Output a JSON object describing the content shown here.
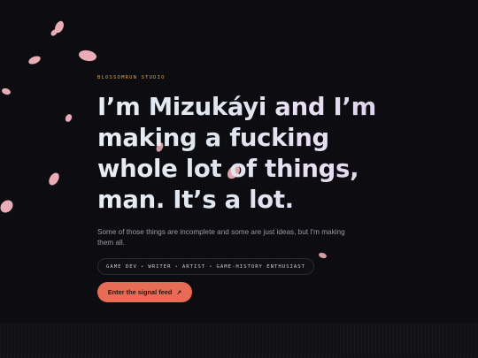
{
  "hero": {
    "eyebrow": "BLOSSOMRUN STUDIO",
    "headline_lines": [
      "I’m Mizukáyi and I’m",
      "making a fucking",
      "whole lot of things,",
      "man. It’s a lot."
    ],
    "subtext": "Some of those things are incomplete and some are just ideas, but I'm making them all.",
    "roles": [
      "GAME DEV",
      "WRITER",
      "ARTIST",
      "GAME-HISTORY ENTHUSIAST"
    ],
    "role_separator": "•",
    "cta_label": "Enter the signal feed",
    "cta_icon": "↗"
  },
  "colors": {
    "background": "#0c0c10",
    "accent": "#e86c55",
    "eyebrow": "#d9a24a",
    "petal": "#f7b5c0"
  },
  "icons": {
    "cta": "arrow-up-right-icon",
    "decor": "sakura-petal-icon"
  }
}
